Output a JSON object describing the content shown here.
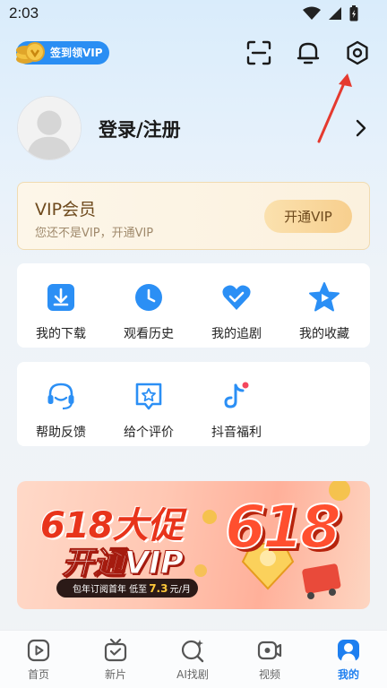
{
  "status_bar": {
    "time": "2:03"
  },
  "header": {
    "signin_label": "签到领VIP",
    "icons": [
      "scan-icon",
      "notification-bell-icon",
      "settings-gear-icon"
    ]
  },
  "profile": {
    "login_label": "登录/注册"
  },
  "vip": {
    "title": "VIP会员",
    "subtitle": "您还不是VIP，开通VIP",
    "button": "开通VIP"
  },
  "grid1": [
    {
      "label": "我的下载",
      "icon": "download-icon"
    },
    {
      "label": "观看历史",
      "icon": "history-clock-icon"
    },
    {
      "label": "我的追剧",
      "icon": "follow-heart-icon"
    },
    {
      "label": "我的收藏",
      "icon": "favorite-star-icon"
    }
  ],
  "grid2": [
    {
      "label": "帮助反馈",
      "icon": "headset-icon"
    },
    {
      "label": "给个评价",
      "icon": "rate-star-icon"
    },
    {
      "label": "抖音福利",
      "icon": "douyin-icon"
    }
  ],
  "banner": {
    "line1": "618大促",
    "line2": "开通VIP",
    "badge": "618",
    "promo_prefix": "包年订阅首年  低至",
    "promo_price": "7.3",
    "promo_suffix": "元/月"
  },
  "tabs": [
    {
      "label": "首页",
      "icon": "home-play-icon"
    },
    {
      "label": "新片",
      "icon": "tv-icon"
    },
    {
      "label": "AI找剧",
      "icon": "ai-search-icon"
    },
    {
      "label": "视频",
      "icon": "video-camera-icon"
    },
    {
      "label": "我的",
      "icon": "profile-icon",
      "active": true
    }
  ],
  "colors": {
    "accent": "#1e7ff0",
    "vip_gold": "#6e4a1d",
    "promo_red": "#e8341b"
  }
}
